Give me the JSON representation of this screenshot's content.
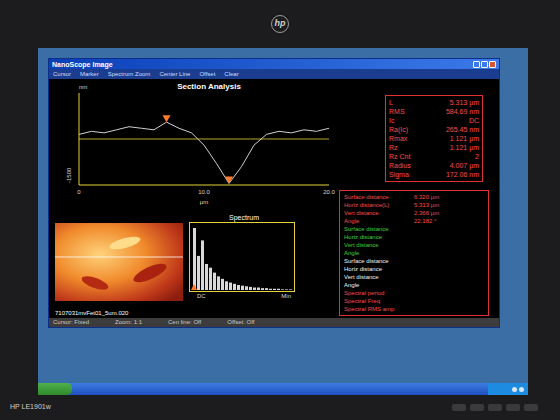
{
  "monitor": {
    "brand": "hp",
    "model": "HP LE1901w"
  },
  "window": {
    "title": "NanoScope Image"
  },
  "menu": [
    "Cursor",
    "Marker",
    "Spectrum Zoom",
    "Center Line",
    "Offset",
    "Clear"
  ],
  "section_chart": {
    "title": "Section Analysis",
    "y_unit": "nm",
    "y_ticks": [
      "-1500"
    ],
    "x_ticks": [
      "0",
      "10.0",
      "20.0"
    ],
    "x_unit": "µm",
    "y_range": [
      -1500,
      1500
    ],
    "x_range": [
      0,
      20
    ],
    "profile": [
      150,
      250,
      200,
      300,
      400,
      350,
      300,
      550,
      350,
      200,
      -200,
      -800,
      -1450,
      -900,
      -200,
      150,
      250,
      200,
      300,
      250,
      350
    ],
    "markers": [
      {
        "x": 7,
        "y": 550
      },
      {
        "x": 12,
        "y": -1450
      }
    ]
  },
  "spectrum": {
    "title": "Spectrum",
    "x_labels": [
      "DC",
      "Min"
    ],
    "bars": [
      100,
      55,
      80,
      42,
      36,
      28,
      22,
      18,
      14,
      12,
      10,
      8,
      7,
      6,
      5,
      4,
      4,
      3,
      3,
      2,
      2,
      2,
      1,
      1,
      1
    ]
  },
  "image": {
    "filename": "7107031mvFet01_5um.020"
  },
  "stats": [
    {
      "label": "L",
      "value": "5.313 µm"
    },
    {
      "label": "RMS",
      "value": "584.69 nm"
    },
    {
      "label": "Ic",
      "value": "DC"
    },
    {
      "label": "Ra(Ic)",
      "value": "265.45 nm"
    },
    {
      "label": "Rmax",
      "value": "1.121 µm"
    },
    {
      "label": "Rz",
      "value": "1.121 µm"
    },
    {
      "label": "Rz Cnt",
      "value": "2"
    },
    {
      "label": "Radius",
      "value": "4.007 µm"
    },
    {
      "label": "Sigma",
      "value": "172.06 nm"
    }
  ],
  "measurements": [
    {
      "label": "Surface distance",
      "value": "6.320 µm",
      "color": "#ff4a4a"
    },
    {
      "label": "Horiz distance(L)",
      "value": "5.313 µm",
      "color": "#ff4a4a"
    },
    {
      "label": "Vert distance",
      "value": "2.366 µm",
      "color": "#ff4a4a"
    },
    {
      "label": "Angle",
      "value": "22.182 °",
      "color": "#ff4a4a"
    },
    {
      "label": "Surface distance",
      "value": "",
      "color": "#3fd23f"
    },
    {
      "label": "Horiz distance",
      "value": "",
      "color": "#3fd23f"
    },
    {
      "label": "Vert distance",
      "value": "",
      "color": "#3fd23f"
    },
    {
      "label": "Angle",
      "value": "",
      "color": "#3fd23f"
    },
    {
      "label": "Surface distance",
      "value": "",
      "color": "#f2f2f2"
    },
    {
      "label": "Horiz distance",
      "value": "",
      "color": "#f2f2f2"
    },
    {
      "label": "Vert distance",
      "value": "",
      "color": "#f2f2f2"
    },
    {
      "label": "Angle",
      "value": "",
      "color": "#f2f2f2"
    },
    {
      "label": "Spectral period",
      "value": "",
      "color": "#ff4a4a"
    },
    {
      "label": "Spectral Freq",
      "value": "",
      "color": "#ff4a4a"
    },
    {
      "label": "Spectral RMS amp",
      "value": "",
      "color": "#ff4a4a"
    }
  ],
  "status_bar": [
    "Cursor: Fixed",
    "Zoom: 1:1",
    "Cen line: Off",
    "Offset: Off"
  ]
}
